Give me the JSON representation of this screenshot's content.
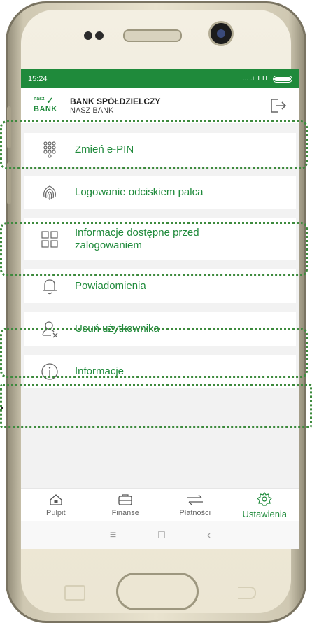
{
  "status": {
    "time": "15:24",
    "signal": "... .ıl LTE"
  },
  "header": {
    "logo_top": "nasz",
    "logo_bottom": "BANK",
    "bank_name": "BANK SPÓŁDZIELCZY",
    "bank_sub": "NASZ BANK"
  },
  "menu": [
    {
      "label_1": "Zmień e-PIN",
      "label_2": "",
      "icon": "keypad-icon"
    },
    {
      "label_1": "Logowanie odciskiem palca",
      "label_2": "",
      "icon": "fingerprint-icon"
    },
    {
      "label_1": "Informacje dostępne przed",
      "label_2": "zalogowaniem",
      "icon": "grid-icon"
    },
    {
      "label_1": "Powiadomienia",
      "label_2": "",
      "icon": "bell-icon"
    },
    {
      "label_1": "Usuń użytkownika",
      "label_2": "",
      "icon": "remove-user-icon"
    },
    {
      "label_1": "Informacje",
      "label_2": "",
      "icon": "info-icon"
    }
  ],
  "nav": [
    {
      "label": "Pulpit",
      "icon": "home-icon"
    },
    {
      "label": "Finanse",
      "icon": "wallet-icon"
    },
    {
      "label": "Płatności",
      "icon": "transfer-icon"
    },
    {
      "label": "Ustawienia",
      "icon": "settings-icon",
      "active": true
    }
  ],
  "colors": {
    "brand_green": "#1f8a3b",
    "highlight": "#3d8a3d"
  }
}
